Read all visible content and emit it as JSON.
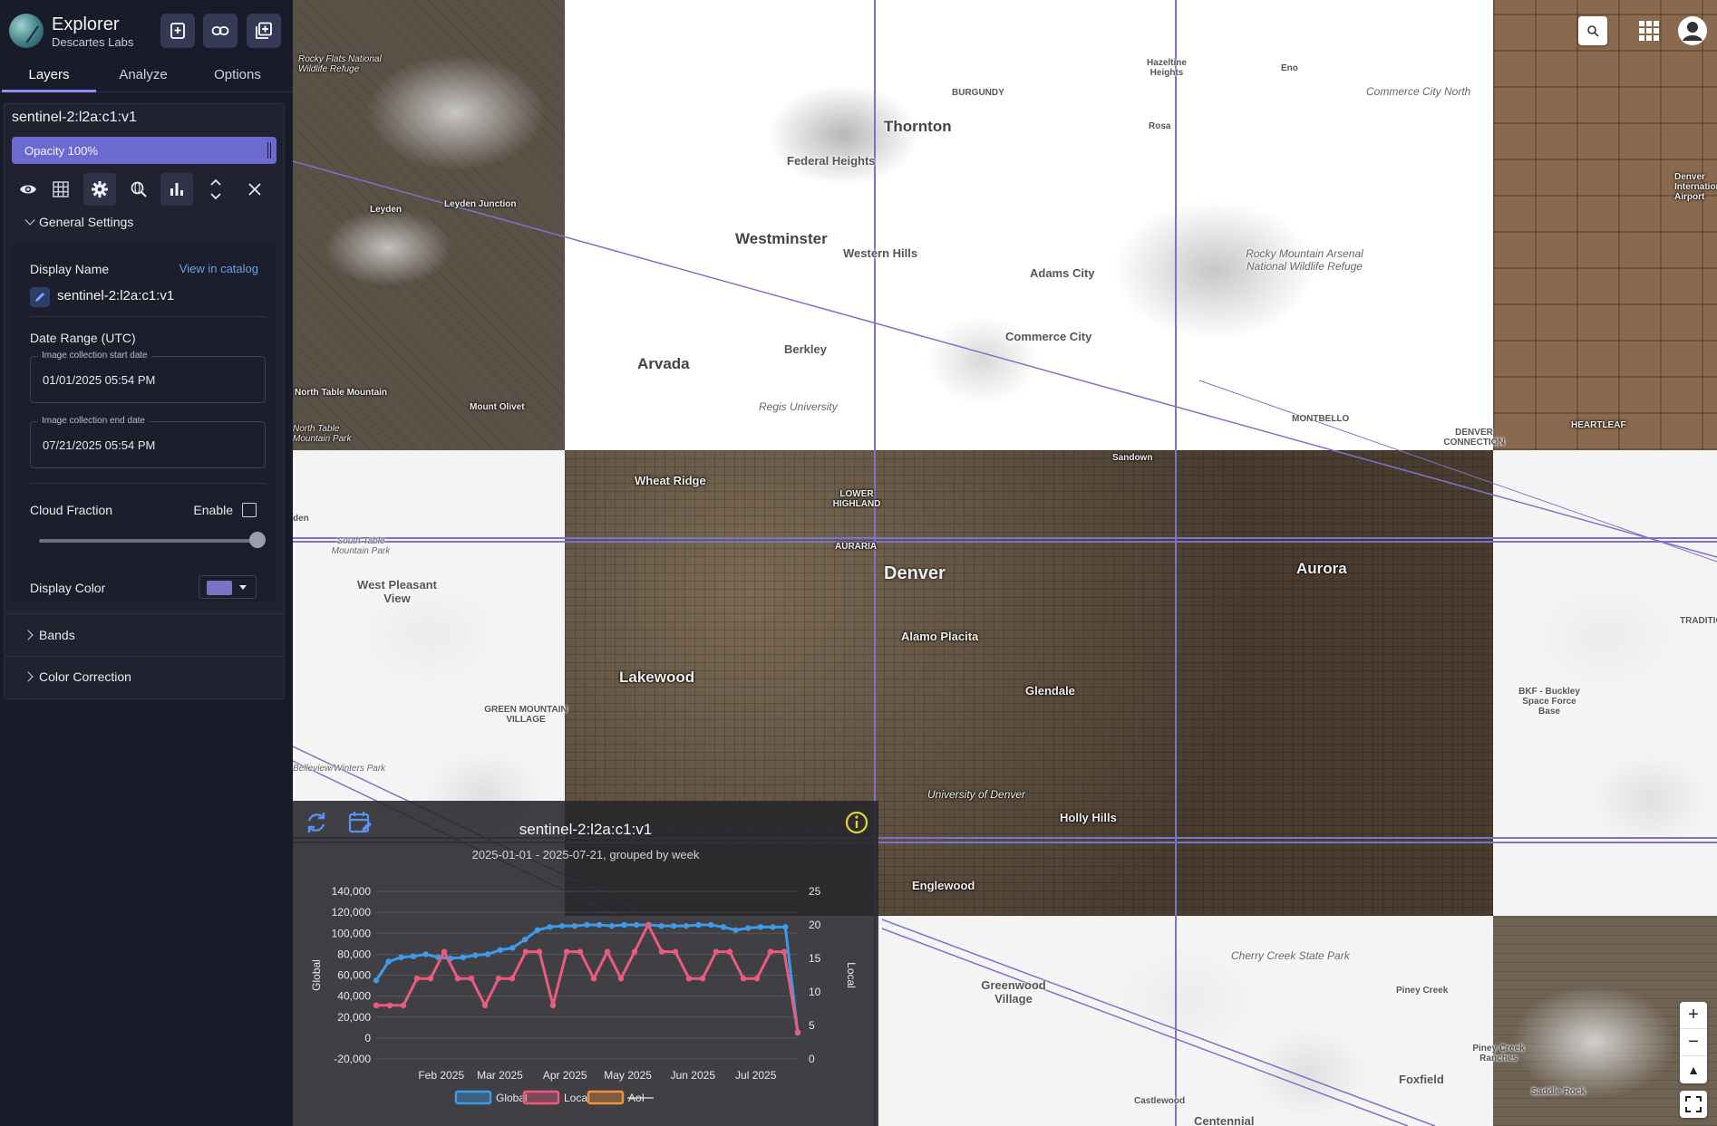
{
  "app": {
    "title": "Explorer",
    "subtitle": "Descartes Labs"
  },
  "tabs": [
    {
      "label": "Layers",
      "active": true
    },
    {
      "label": "Analyze",
      "active": false
    },
    {
      "label": "Options",
      "active": false
    }
  ],
  "layer": {
    "name": "sentinel-2:l2a:c1:v1",
    "opacity_label": "Opacity 100%",
    "opacity": 1.0
  },
  "general_settings": {
    "heading": "General Settings",
    "display_name_label": "Display Name",
    "view_in_catalog": "View in catalog",
    "display_name_value": "sentinel-2:l2a:c1:v1",
    "date_range_label": "Date Range (UTC)",
    "start_legend": "Image collection start date",
    "start_value": "01/01/2025 05:54 PM",
    "end_legend": "Image collection end date",
    "end_value": "07/21/2025 05:54 PM",
    "cloud_fraction_label": "Cloud Fraction",
    "enable_label": "Enable",
    "enable_checked": false,
    "cloud_fraction_value": 1.0,
    "display_color_label": "Display Color",
    "display_color": "#7a73c4"
  },
  "sections": {
    "bands": "Bands",
    "color_correction": "Color Correction"
  },
  "colors": {
    "accent": "#6c6ad1",
    "global": "#3d9be9",
    "local": "#ec5b7d",
    "aoi": "#f0913b",
    "footprint": "#7b73c7"
  },
  "map_labels": [
    {
      "text": "Rocky Flats National Wildlife Refuge",
      "cls": "it dark small"
    },
    {
      "text": "Leyden",
      "cls": "dark small"
    },
    {
      "text": "Leyden Junction",
      "cls": "dark small"
    },
    {
      "text": "North Table Mountain",
      "cls": "dark small"
    },
    {
      "text": "Mount Olivet",
      "cls": "dark small"
    },
    {
      "text": "North Table Mountain Park",
      "cls": "it dark small"
    },
    {
      "text": "BURGUNDY",
      "cls": "small"
    },
    {
      "text": "Thornton",
      "cls": "big"
    },
    {
      "text": "Federal Heights",
      "cls": ""
    },
    {
      "text": "Westminster",
      "cls": "big"
    },
    {
      "text": "Western Hills",
      "cls": ""
    },
    {
      "text": "Adams City",
      "cls": ""
    },
    {
      "text": "Commerce City",
      "cls": ""
    },
    {
      "text": "Berkley",
      "cls": ""
    },
    {
      "text": "Arvada",
      "cls": "big"
    },
    {
      "text": "Regis University",
      "cls": "it"
    },
    {
      "text": "Hazeltine Heights",
      "cls": "small"
    },
    {
      "text": "Eno",
      "cls": "small"
    },
    {
      "text": "Rosa",
      "cls": "small"
    },
    {
      "text": "Commerce City North",
      "cls": "it"
    },
    {
      "text": "Rocky Mountain Arsenal National Wildlife Refuge",
      "cls": "it"
    },
    {
      "text": "MONTBELLO",
      "cls": "small"
    },
    {
      "text": "DENVER CONNECTION",
      "cls": "small"
    },
    {
      "text": "Denver International Airport",
      "cls": "dark small"
    },
    {
      "text": "HEARTLEAF",
      "cls": "dark small"
    },
    {
      "text": "Wheat Ridge",
      "cls": "dark"
    },
    {
      "text": "LOWER HIGHLAND",
      "cls": "dark small"
    },
    {
      "text": "AURARIA",
      "cls": "dark small"
    },
    {
      "text": "Sandown",
      "cls": "dark small"
    },
    {
      "text": "Denver",
      "cls": "huge"
    },
    {
      "text": "Aurora",
      "cls": "dark big"
    },
    {
      "text": "Alamo Placita",
      "cls": "dark"
    },
    {
      "text": "Glendale",
      "cls": "dark"
    },
    {
      "text": "Lakewood",
      "cls": "dark big"
    },
    {
      "text": "University of Denver",
      "cls": "it dark"
    },
    {
      "text": "Holly Hills",
      "cls": "dark"
    },
    {
      "text": "Englewood",
      "cls": "dark"
    },
    {
      "text": "den",
      "cls": "small"
    },
    {
      "text": "South Table Mountain Park",
      "cls": "it small"
    },
    {
      "text": "West Pleasant View",
      "cls": ""
    },
    {
      "text": "GREEN MOUNTAIN VILLAGE",
      "cls": "small"
    },
    {
      "text": "Belleview/Winters Park",
      "cls": "it small"
    },
    {
      "text": "BKF - Buckley Space Force Base",
      "cls": "small"
    },
    {
      "text": "TRADITIONS",
      "cls": "small"
    },
    {
      "text": "Cherry Creek State Park",
      "cls": "it"
    },
    {
      "text": "Greenwood Village",
      "cls": ""
    },
    {
      "text": "Piney Creek",
      "cls": "small"
    },
    {
      "text": "Piney Creek Ranches",
      "cls": "small"
    },
    {
      "text": "Foxfield",
      "cls": ""
    },
    {
      "text": "Castlewood",
      "cls": "small"
    },
    {
      "text": "Centennial",
      "cls": ""
    },
    {
      "text": "Saddle Rock",
      "cls": "small"
    }
  ],
  "chart_data": {
    "type": "line",
    "title": "sentinel-2:l2a:c1:v1",
    "subtitle": "2025-01-01 - 2025-07-21, grouped by week",
    "ylabel": "Global",
    "y2label": "Local",
    "ylim": [
      -20000,
      140000
    ],
    "y_ticks": [
      "140,000",
      "120,000",
      "100,000",
      "80,000",
      "60,000",
      "40,000",
      "20,000",
      "0",
      "-20,000"
    ],
    "y2lim": [
      0,
      25
    ],
    "y2_ticks": [
      "25",
      "20",
      "15",
      "10",
      "5",
      "0"
    ],
    "x_ticks": [
      "Feb 2025",
      "Mar 2025",
      "Apr 2025",
      "May 2025",
      "Jun 2025",
      "Jul 2025"
    ],
    "x_start": "2025-01-01",
    "x_end": "2025-07-21",
    "series": [
      {
        "name": "Global",
        "axis": "left",
        "values": [
          55000,
          73000,
          77000,
          78000,
          80000,
          77000,
          76000,
          77000,
          79000,
          80000,
          84000,
          86000,
          94000,
          103000,
          106000,
          107000,
          107000,
          108000,
          108000,
          107000,
          108000,
          108000,
          108000,
          107000,
          107000,
          107000,
          108000,
          108000,
          106000,
          103000,
          105000,
          106000,
          106000,
          106000,
          5000
        ]
      },
      {
        "name": "Local",
        "axis": "right",
        "values": [
          8,
          8,
          8,
          12,
          12,
          16,
          12,
          12,
          8,
          12,
          12,
          16,
          16,
          8,
          16,
          16,
          12,
          16,
          12,
          16,
          20,
          16,
          16,
          12,
          12,
          16,
          16,
          12,
          12,
          16,
          16,
          4
        ]
      },
      {
        "name": "AoI",
        "axis": "right",
        "values": [],
        "hidden": true
      }
    ],
    "legend": [
      "Global",
      "Local",
      "AoI"
    ],
    "legend_position": "bottom"
  }
}
